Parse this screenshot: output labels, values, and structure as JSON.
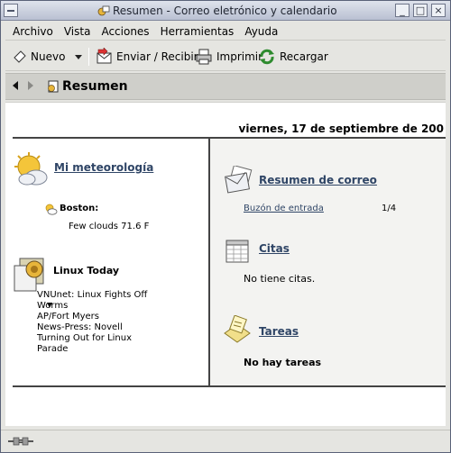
{
  "window": {
    "title": "Resumen - Correo eletrónico y calendario",
    "btn_minimize": "_",
    "btn_maximize": "□",
    "btn_close": "×"
  },
  "menubar": {
    "items": [
      "Archivo",
      "Vista",
      "Acciones",
      "Herramientas",
      "Ayuda"
    ]
  },
  "toolbar": {
    "new_label": "Nuevo",
    "send_receive_label": "Enviar / Recibir",
    "print_label": "Imprimir",
    "reload_label": "Recargar"
  },
  "navbar": {
    "title": "Resumen"
  },
  "summary": {
    "date": "viernes, 17 de septiembre de 200",
    "weather": {
      "title": "Mi meteorología",
      "city": "Boston:",
      "condition": "Few clouds 71.6 F"
    },
    "news": {
      "title": "Linux Today",
      "items": [
        "VNUnet: Linux Fights Off",
        "Worms",
        "AP/Fort Myers",
        "News-Press: Novell",
        "Turning Out for Linux",
        "Parade"
      ]
    },
    "mail": {
      "title": "Resumen de correo",
      "folder": "Buzón de entrada",
      "count": "1/4"
    },
    "appointments": {
      "title": "Citas",
      "empty_text": "No tiene citas."
    },
    "tasks": {
      "title": "Tareas",
      "empty_text": "No hay tareas"
    }
  }
}
